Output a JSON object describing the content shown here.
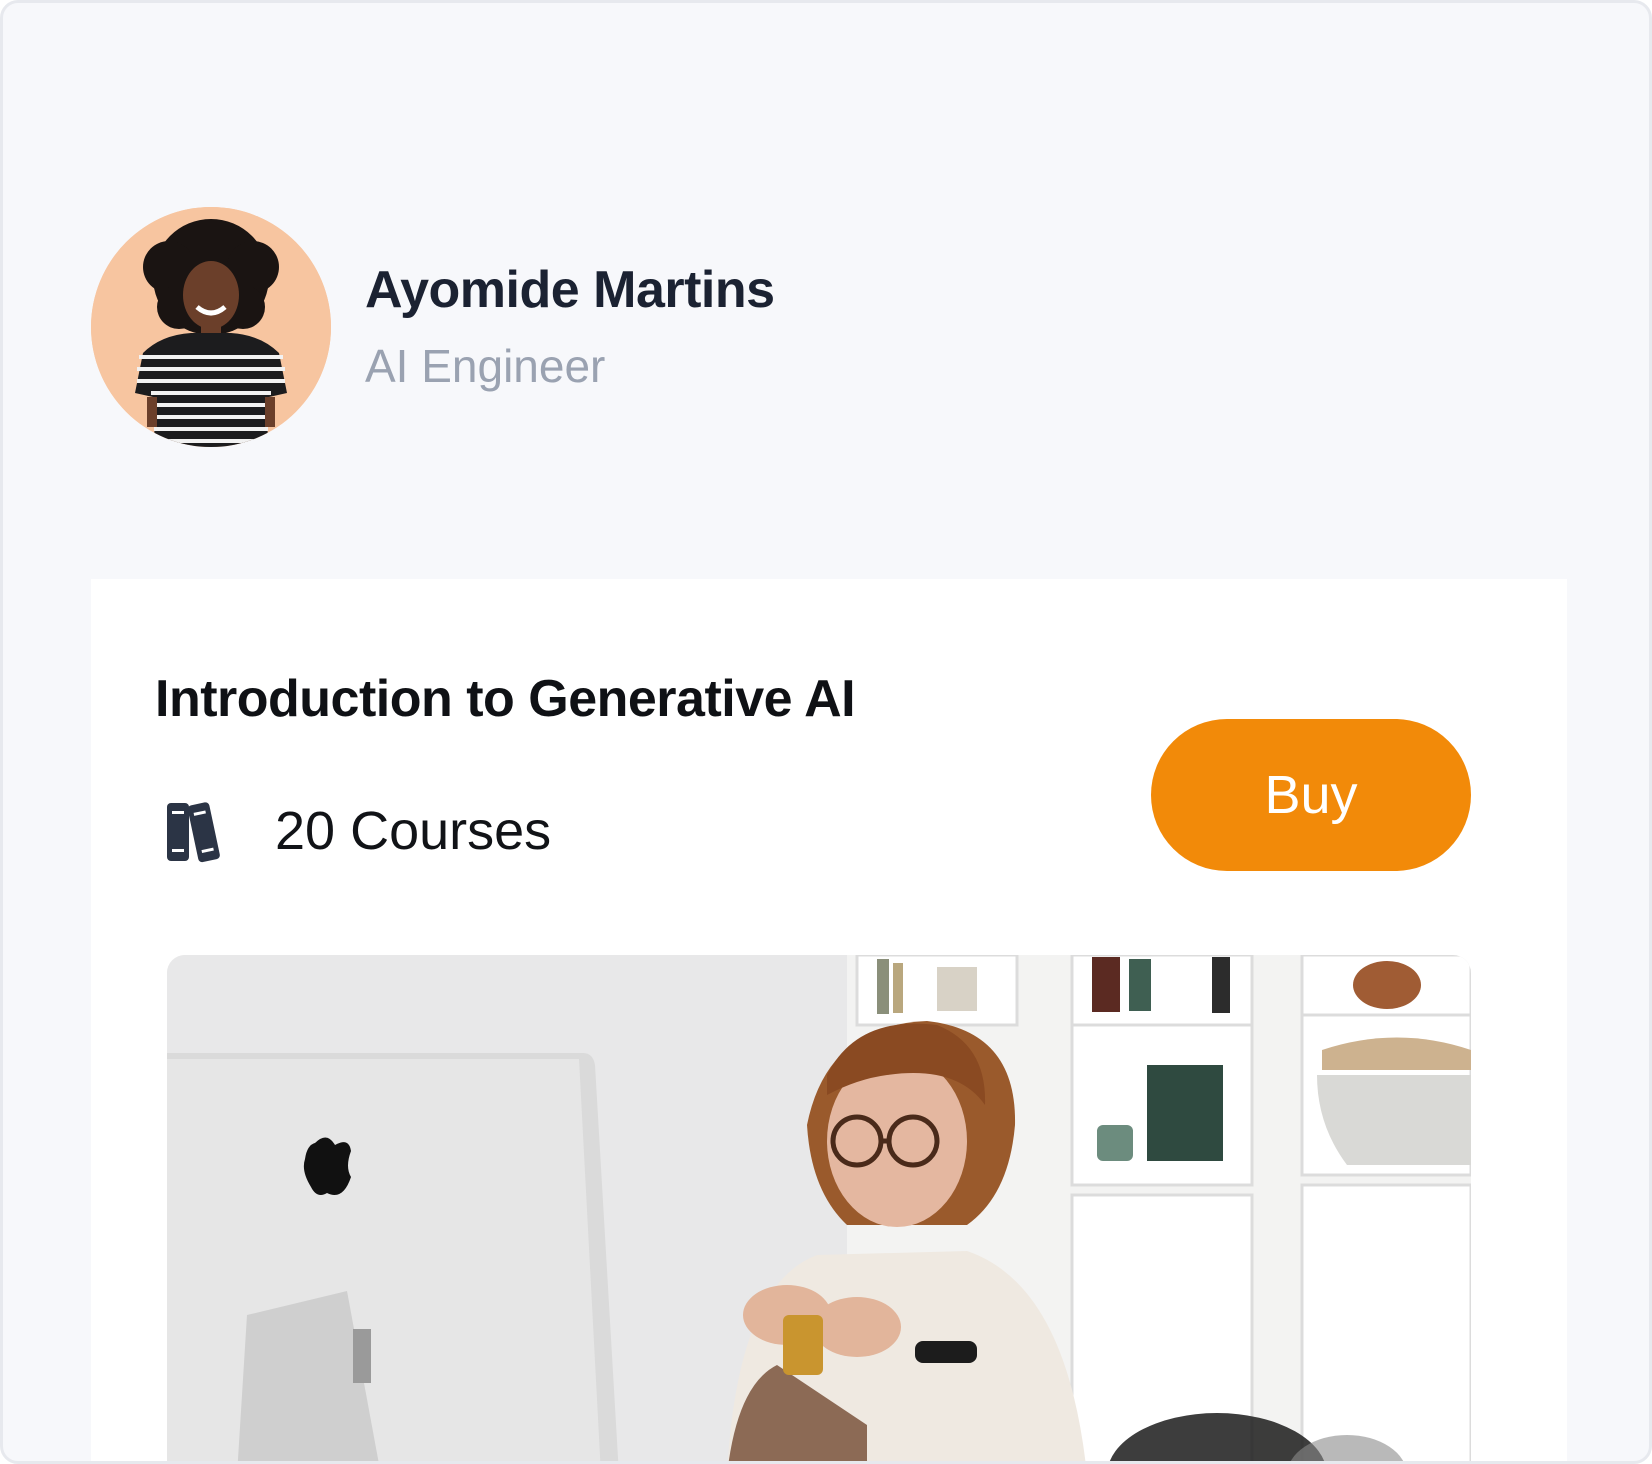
{
  "instructor": {
    "name": "Ayomide Martins",
    "role": "AI Engineer",
    "avatar_icon": "person-avatar"
  },
  "course": {
    "title": "Introduction to Generative AI",
    "count_label": "20 Courses",
    "count_icon": "books-icon",
    "buy_label": "Buy",
    "image_icon": "course-photo"
  },
  "colors": {
    "background": "#f7f8fb",
    "card": "#ffffff",
    "accent": "#f28a09",
    "name": "#1b2232",
    "role": "#9aa2b1",
    "icon": "#2b3445"
  }
}
